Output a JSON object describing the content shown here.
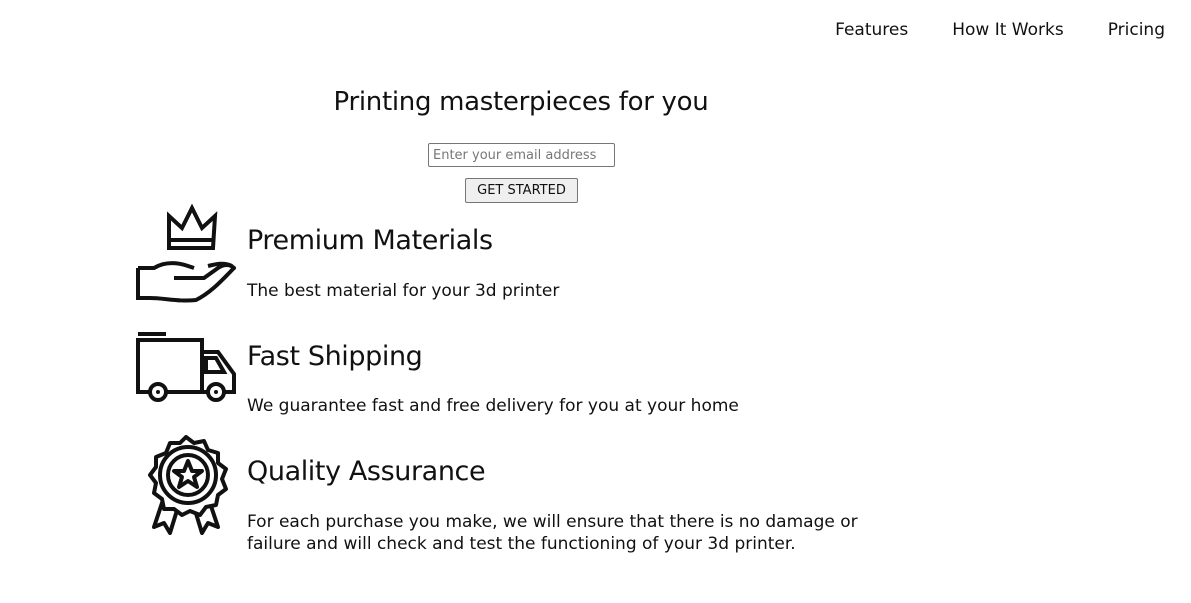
{
  "nav": {
    "items": [
      {
        "label": "Features"
      },
      {
        "label": "How It Works"
      },
      {
        "label": "Pricing"
      }
    ]
  },
  "hero": {
    "title": "Printing masterpieces for you",
    "email_placeholder": "Enter your email address",
    "cta_label": "GET STARTED"
  },
  "features": [
    {
      "icon": "crown-hand-icon",
      "title": "Premium Materials",
      "description": "The best material for your 3d printer"
    },
    {
      "icon": "delivery-truck-icon",
      "title": "Fast Shipping",
      "description": "We guarantee fast and free delivery for you at your home"
    },
    {
      "icon": "award-badge-icon",
      "title": "Quality Assurance",
      "description": "For each purchase you make, we will ensure that there is no damage or failure and will check and test the functioning of your 3d printer."
    }
  ]
}
